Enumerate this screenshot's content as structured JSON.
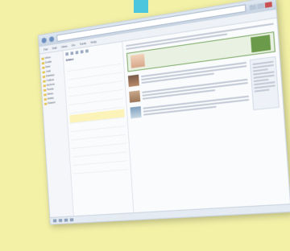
{
  "window": {
    "address": "",
    "menu": [
      "File",
      "Edit",
      "View",
      "Go",
      "Tools",
      "Help"
    ]
  },
  "folders": [
    "Inbox",
    "Drafts",
    "Sent",
    "Junk",
    "Deleted",
    "Outbox",
    "Archive",
    "Feeds",
    "News",
    "Notes",
    "Search"
  ],
  "message_list": {
    "header": "Inbox",
    "messages": [
      {
        "sender": "",
        "time": ""
      },
      {
        "sender": "",
        "time": ""
      },
      {
        "sender": "",
        "time": ""
      },
      {
        "sender": "",
        "time": ""
      },
      {
        "sender": "",
        "time": ""
      },
      {
        "sender": "",
        "time": ""
      },
      {
        "sender": "",
        "time": "",
        "highlighted": true
      },
      {
        "sender": "",
        "time": ""
      },
      {
        "sender": "",
        "time": ""
      },
      {
        "sender": "",
        "time": ""
      },
      {
        "sender": "",
        "time": ""
      },
      {
        "sender": "",
        "time": ""
      },
      {
        "sender": "",
        "time": ""
      }
    ]
  },
  "reading_pane": {
    "subject": "",
    "meta": "",
    "banner_text": "",
    "articles": [
      {
        "title": "",
        "thumb": "portrait-dark"
      },
      {
        "title": "",
        "thumb": "portrait-light"
      },
      {
        "title": "",
        "thumb": "landscape"
      }
    ],
    "sidebar_title": ""
  },
  "colors": {
    "background": "#f3f1a6",
    "accent": "#4cc6dc",
    "highlight": "#fcf3b8",
    "banner": "#6a9a4a"
  }
}
